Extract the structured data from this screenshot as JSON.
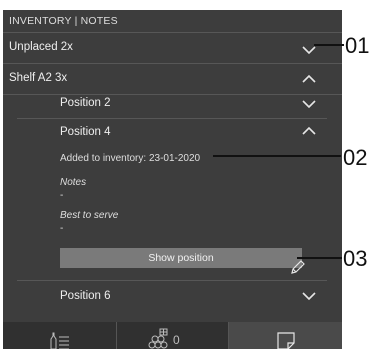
{
  "header": {
    "title": "INVENTORY | NOTES"
  },
  "rows": {
    "unplaced": {
      "label": "Unplaced 2x"
    },
    "shelf": {
      "label": "Shelf A2 3x"
    },
    "position2": {
      "label": "Position 2"
    },
    "position4": {
      "label": "Position 4",
      "added": "Added to inventory: 23-01-2020",
      "notes_label": "Notes",
      "notes_value": "-",
      "best_label": "Best to serve",
      "best_value": "-",
      "button": "Show position"
    },
    "position6": {
      "label": "Position 6"
    }
  },
  "tabbar": {
    "bottles_count": "0"
  },
  "callouts": [
    "01",
    "02",
    "03"
  ],
  "icons": [
    "chevron-down-icon",
    "chevron-up-icon",
    "pencil-icon",
    "bottle-list-icon",
    "bottles-icon",
    "note-icon"
  ],
  "colors": {
    "background": "#3d3d3d",
    "button": "#7a7a7a",
    "tabbar": "#303030"
  }
}
